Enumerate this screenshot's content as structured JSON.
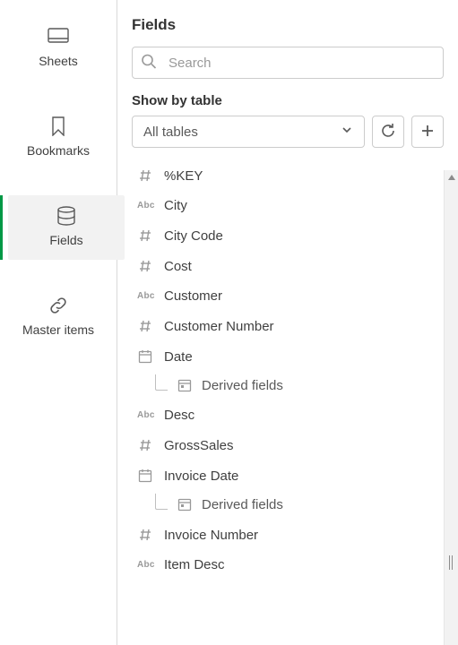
{
  "nav": {
    "sheets": "Sheets",
    "bookmarks": "Bookmarks",
    "fields": "Fields",
    "master_items": "Master items"
  },
  "panel": {
    "title": "Fields",
    "search_placeholder": "Search",
    "showby_label": "Show by table",
    "tables_selected": "All tables"
  },
  "fields": [
    {
      "type": "hash",
      "label": "%KEY"
    },
    {
      "type": "abc",
      "label": "City"
    },
    {
      "type": "hash",
      "label": "City Code"
    },
    {
      "type": "hash",
      "label": "Cost"
    },
    {
      "type": "abc",
      "label": "Customer"
    },
    {
      "type": "hash",
      "label": "Customer Number"
    },
    {
      "type": "date",
      "label": "Date",
      "derived": "Derived fields"
    },
    {
      "type": "abc",
      "label": "Desc"
    },
    {
      "type": "hash",
      "label": "GrossSales"
    },
    {
      "type": "date",
      "label": "Invoice Date",
      "derived": "Derived fields"
    },
    {
      "type": "hash",
      "label": "Invoice Number"
    },
    {
      "type": "abc",
      "label": "Item Desc"
    }
  ]
}
